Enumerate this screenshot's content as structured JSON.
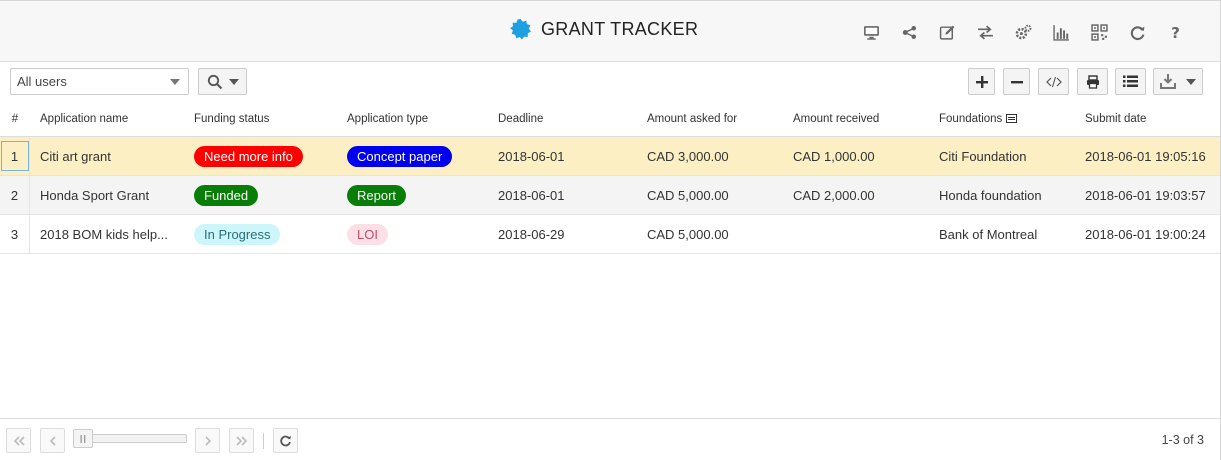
{
  "header": {
    "title": "GRANT TRACKER",
    "icons": [
      "monitor-icon",
      "share-icon",
      "edit-icon",
      "swap-icon",
      "settings-icon",
      "chart-icon",
      "qrcode-icon",
      "refresh-icon",
      "help-icon"
    ]
  },
  "toolbar": {
    "user_filter": "All users",
    "buttons": [
      "add-icon",
      "remove-icon",
      "code-icon",
      "print-icon",
      "list-icon",
      "download-icon"
    ]
  },
  "grid": {
    "columns": [
      "#",
      "Application name",
      "Funding status",
      "Application type",
      "Deadline",
      "Amount asked for",
      "Amount received",
      "Foundations",
      "Submit date"
    ],
    "rows": [
      {
        "num": "1",
        "name": "Citi art grant",
        "status": {
          "label": "Need more info",
          "bg": "#ff0000",
          "fg": "#ffffff"
        },
        "type": {
          "label": "Concept paper",
          "bg": "#0000ee",
          "fg": "#ffffff"
        },
        "deadline": "2018-06-01",
        "asked": "CAD 3,000.00",
        "received": "CAD 1,000.00",
        "foundation": "Citi Foundation",
        "submit": "2018-06-01 19:05:16"
      },
      {
        "num": "2",
        "name": "Honda Sport Grant",
        "status": {
          "label": "Funded",
          "bg": "#087d08",
          "fg": "#ffffff"
        },
        "type": {
          "label": "Report",
          "bg": "#087d08",
          "fg": "#ffffff"
        },
        "deadline": "2018-06-01",
        "asked": "CAD 5,000.00",
        "received": "CAD 2,000.00",
        "foundation": "Honda foundation",
        "submit": "2018-06-01 19:03:57"
      },
      {
        "num": "3",
        "name": "2018 BOM kids help...",
        "status": {
          "label": "In Progress",
          "bg": "#cdf6fa",
          "fg": "#2b6f7a"
        },
        "type": {
          "label": "LOI",
          "bg": "#fde0e6",
          "fg": "#c0506a"
        },
        "deadline": "2018-06-29",
        "asked": "CAD 5,000.00",
        "received": "",
        "foundation": "Bank of Montreal",
        "submit": "2018-06-01 19:00:24"
      }
    ]
  },
  "footer": {
    "range": "1-3 of 3"
  },
  "colors": {
    "accent": "#1e9fe0",
    "selected_row": "#fcefc3"
  }
}
